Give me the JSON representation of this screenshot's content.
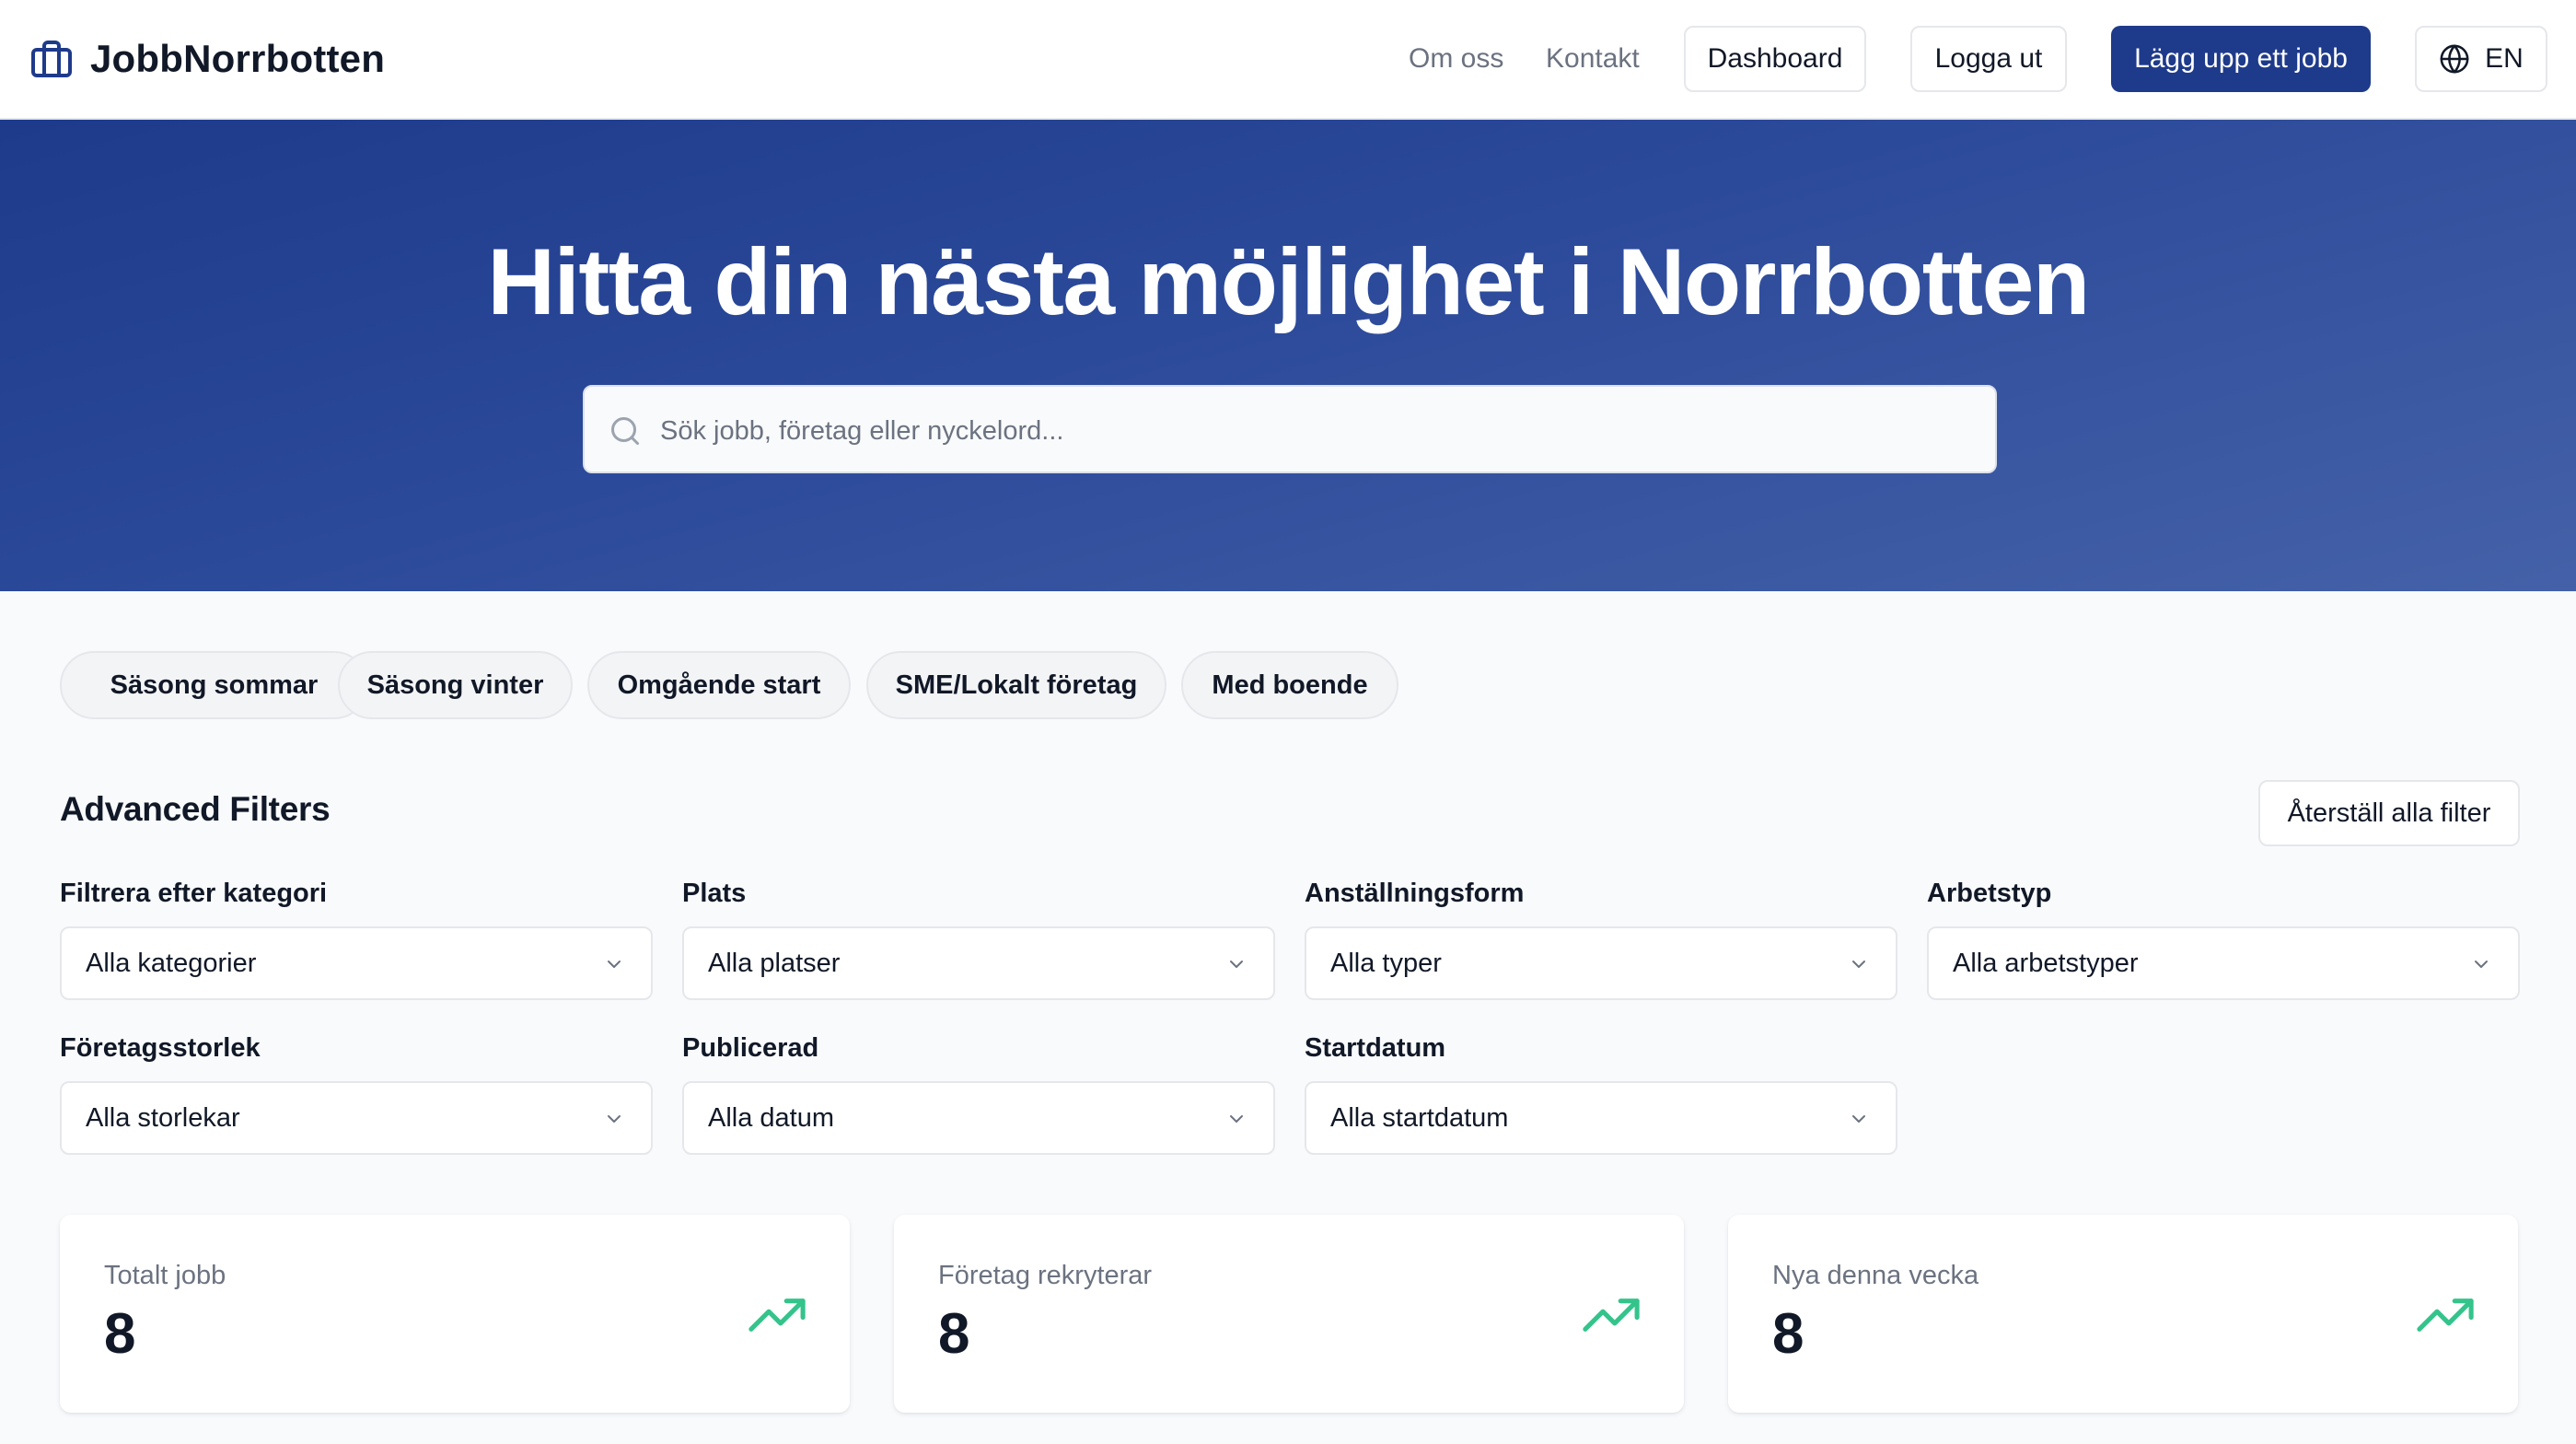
{
  "header": {
    "brand": "JobbNorrbotten",
    "nav": {
      "about": "Om oss",
      "contact": "Kontakt",
      "dashboard": "Dashboard",
      "logout": "Logga ut",
      "post_job": "Lägg upp ett jobb",
      "language": "EN"
    }
  },
  "hero": {
    "title": "Hitta din nästa möjlighet i Norrbotten",
    "search_placeholder": "Sök jobb, företag eller nyckelord..."
  },
  "quick_filters": [
    "Säsong sommar",
    "Säsong vinter",
    "Omgående start",
    "SME/Lokalt företag",
    "Med boende"
  ],
  "filters": {
    "title": "Advanced Filters",
    "reset_label": "Återställ alla filter",
    "fields": [
      {
        "label": "Filtrera efter kategori",
        "value": "Alla kategorier"
      },
      {
        "label": "Plats",
        "value": "Alla platser"
      },
      {
        "label": "Anställningsform",
        "value": "Alla typer"
      },
      {
        "label": "Arbetstyp",
        "value": "Alla arbetstyper"
      },
      {
        "label": "Företagsstorlek",
        "value": "Alla storlekar"
      },
      {
        "label": "Publicerad",
        "value": "Alla datum"
      },
      {
        "label": "Startdatum",
        "value": "Alla startdatum"
      }
    ]
  },
  "stats": [
    {
      "label": "Totalt jobb",
      "value": "8",
      "icon": "trending-up-icon"
    },
    {
      "label": "Företag rekryterar",
      "value": "8",
      "icon": "trending-up-icon"
    },
    {
      "label": "Nya denna vecka",
      "value": "8",
      "icon": "trending-up-icon"
    }
  ],
  "colors": {
    "primary": "#1e3a8a",
    "hero_start": "#1e3a8a",
    "hero_end": "#4461a8",
    "trend_green": "#34c48b",
    "page_bg": "#f8fafc"
  }
}
